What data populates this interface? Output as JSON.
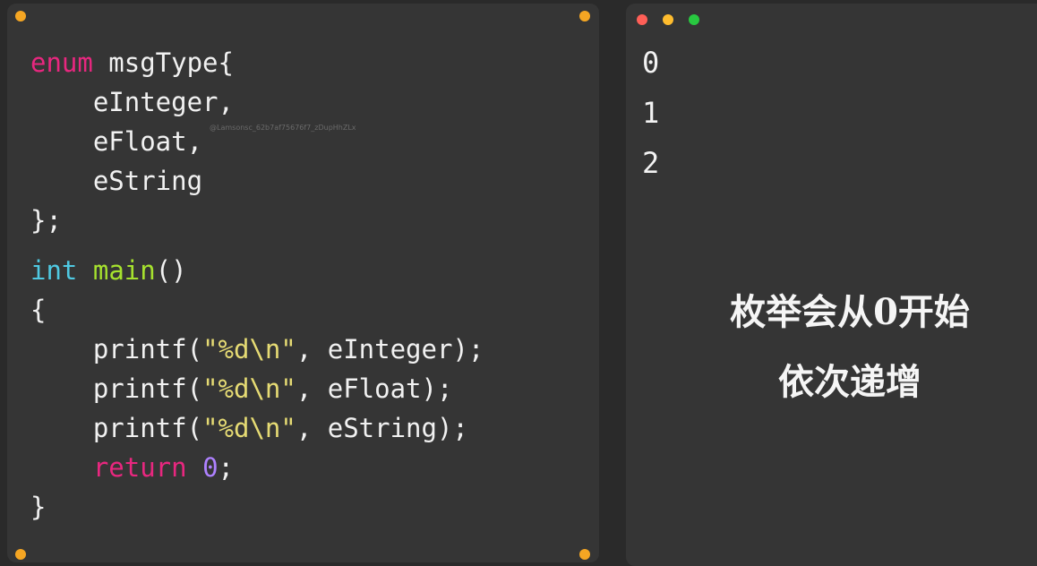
{
  "code_editor": {
    "lines": [
      [
        {
          "t": "enum",
          "c": "kw"
        },
        {
          "t": " msgType{",
          "c": "plain"
        }
      ],
      [
        {
          "t": "    eInteger,",
          "c": "plain"
        }
      ],
      [
        {
          "t": "    eFloat,",
          "c": "plain"
        }
      ],
      [
        {
          "t": "    eString",
          "c": "plain"
        }
      ],
      [
        {
          "t": "};",
          "c": "plain"
        }
      ],
      [
        {
          "t": "int",
          "c": "type"
        },
        {
          "t": " ",
          "c": "plain"
        },
        {
          "t": "main",
          "c": "fn"
        },
        {
          "t": "()",
          "c": "plain"
        }
      ],
      [
        {
          "t": "{",
          "c": "plain"
        }
      ],
      [
        {
          "t": "    printf(",
          "c": "plain"
        },
        {
          "t": "\"%d\\n\"",
          "c": "str"
        },
        {
          "t": ", eInteger);",
          "c": "plain"
        }
      ],
      [
        {
          "t": "    printf(",
          "c": "plain"
        },
        {
          "t": "\"%d\\n\"",
          "c": "str"
        },
        {
          "t": ", eFloat);",
          "c": "plain"
        }
      ],
      [
        {
          "t": "    printf(",
          "c": "plain"
        },
        {
          "t": "\"%d\\n\"",
          "c": "str"
        },
        {
          "t": ", eString);",
          "c": "plain"
        }
      ],
      [
        {
          "t": "    ",
          "c": "plain"
        },
        {
          "t": "return",
          "c": "kw"
        },
        {
          "t": " ",
          "c": "plain"
        },
        {
          "t": "0",
          "c": "num"
        },
        {
          "t": ";",
          "c": "plain"
        }
      ],
      [
        {
          "t": "}",
          "c": "plain"
        }
      ]
    ],
    "watermark": "@Lamsonsc_62b7af75676f7_zDupHhZLx"
  },
  "terminal": {
    "output_lines": [
      "0",
      "1",
      "2"
    ],
    "caption_line1": "枚举会从0开始",
    "caption_line2": "依次递增"
  },
  "colors": {
    "keyword": "#e8277f",
    "type": "#4fc9e2",
    "function": "#a6e22e",
    "string": "#e6db74",
    "number": "#ae81ff",
    "corner_dots": "#f5a623"
  }
}
